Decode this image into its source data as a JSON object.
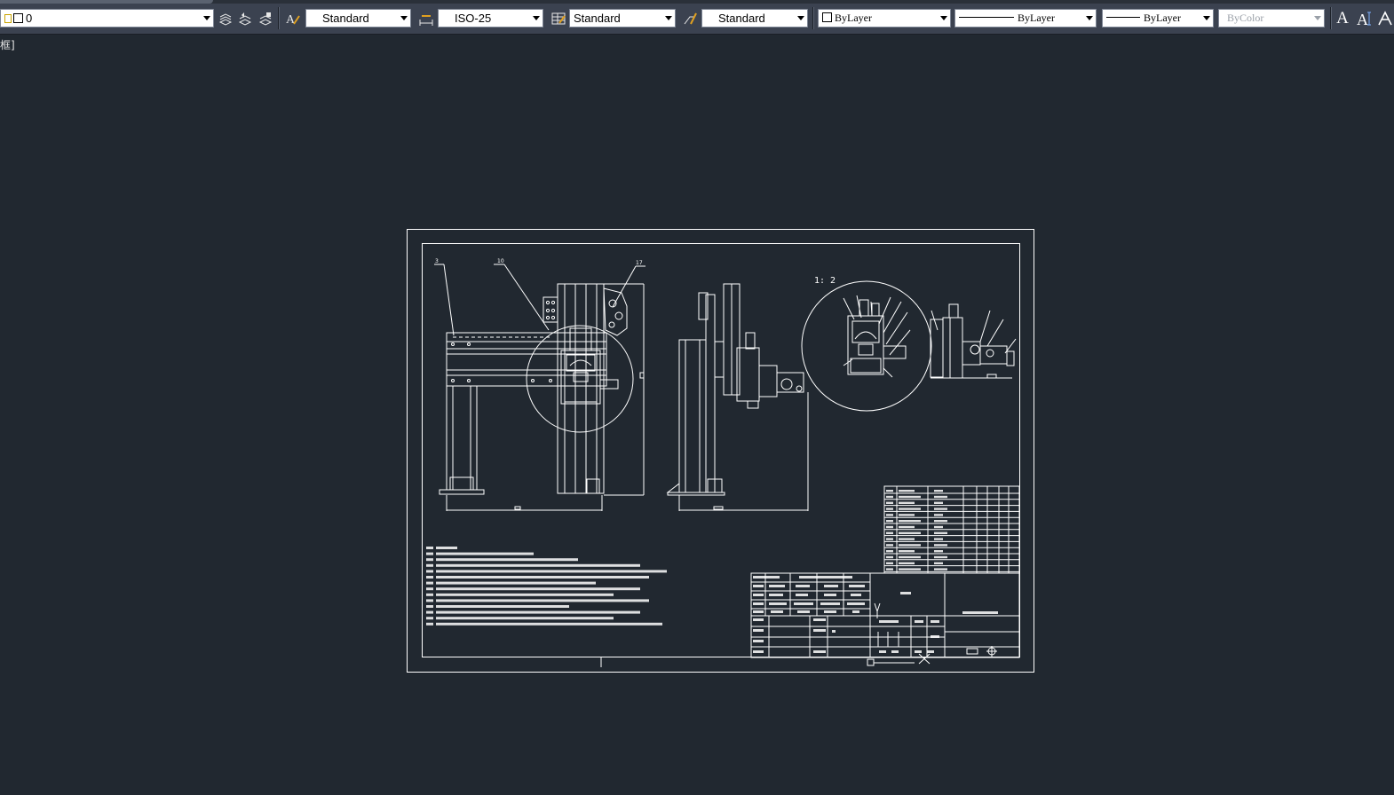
{
  "toolbar": {
    "layer": {
      "value": "0"
    },
    "text_style": {
      "value": "Standard"
    },
    "dim_style": {
      "value": "ISO-25"
    },
    "table_style": {
      "value": "Standard"
    },
    "multileader_style": {
      "value": "Standard"
    },
    "color": {
      "value": "ByLayer"
    },
    "linetype": {
      "value": "ByLayer"
    },
    "lineweight": {
      "value": "ByLayer"
    },
    "plot_style": {
      "value": "ByColor"
    }
  },
  "command_line": {
    "text": "框]"
  },
  "drawing": {
    "scale_label": "1: 2",
    "balloon_labels": [
      "3",
      "10",
      "17"
    ],
    "colors": {
      "line": "#ffffff",
      "background": "#212830"
    }
  }
}
